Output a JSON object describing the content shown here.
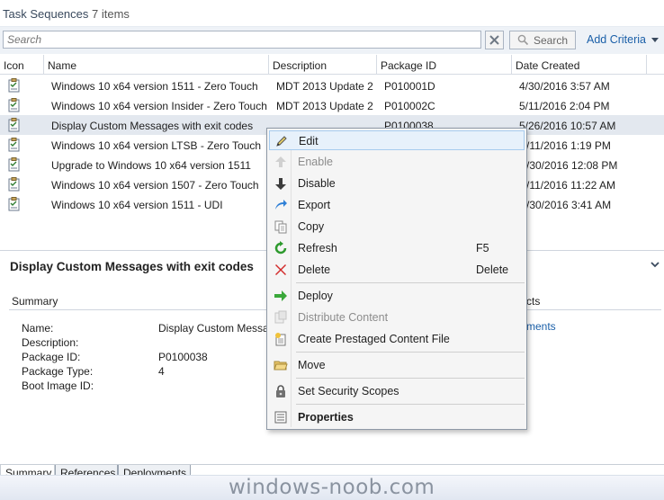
{
  "header": {
    "title": "Task Sequences",
    "count": "7 items"
  },
  "search": {
    "placeholder": "Search",
    "value": "Search",
    "button_label": "Search",
    "add_criteria_label": "Add Criteria"
  },
  "table": {
    "columns": [
      "Icon",
      "Name",
      "Description",
      "Package ID",
      "Date Created"
    ],
    "rows": [
      {
        "name": "Windows 10 x64 version 1511 - Zero Touch",
        "description": "MDT 2013 Update 2",
        "package_id": "P010001D",
        "date_created": "4/30/2016 3:57 AM"
      },
      {
        "name": "Windows 10 x64 version Insider - Zero Touch",
        "description": "MDT 2013 Update 2",
        "package_id": "P010002C",
        "date_created": "5/11/2016 2:04 PM"
      },
      {
        "name": "Display Custom Messages with exit codes",
        "description": "",
        "package_id": "P0100038",
        "date_created": "5/26/2016 10:57 AM"
      },
      {
        "name": "Windows 10 x64 version LTSB - Zero Touch",
        "description": "",
        "package_id": "",
        "date_created": "/11/2016 1:19 PM"
      },
      {
        "name": "Upgrade to Windows 10 x64 version 1511",
        "description": "",
        "package_id": "",
        "date_created": "/30/2016 12:08 PM"
      },
      {
        "name": "Windows 10 x64 version 1507 - Zero Touch",
        "description": "",
        "package_id": "",
        "date_created": "/11/2016 11:22 AM"
      },
      {
        "name": "Windows 10 x64 version 1511 - UDI",
        "description": "",
        "package_id": "",
        "date_created": "/30/2016 3:41 AM"
      }
    ]
  },
  "details": {
    "title": "Display Custom Messages with exit codes",
    "summary_label": "Summary",
    "related_label": "cts",
    "related_link": "ments",
    "props": [
      {
        "name": "Name:",
        "value": "Display Custom Messa"
      },
      {
        "name": "Description:",
        "value": ""
      },
      {
        "name": "Package ID:",
        "value": "P0100038"
      },
      {
        "name": "Package Type:",
        "value": "4"
      },
      {
        "name": "Boot Image ID:",
        "value": ""
      }
    ]
  },
  "bottom_tabs": [
    "Summary",
    "References",
    "Deployments"
  ],
  "watermark": "windows-noob.com",
  "context_menu": {
    "items": [
      {
        "label": "Edit",
        "shortcut": "",
        "icon": "pencil-icon",
        "state": "hover"
      },
      {
        "label": "Enable",
        "shortcut": "",
        "icon": "arrow-up-icon",
        "state": "disabled"
      },
      {
        "label": "Disable",
        "shortcut": "",
        "icon": "arrow-down-icon",
        "state": "normal"
      },
      {
        "label": "Export",
        "shortcut": "",
        "icon": "export-arrow-icon",
        "state": "normal"
      },
      {
        "label": "Copy",
        "shortcut": "",
        "icon": "copy-icon",
        "state": "normal"
      },
      {
        "label": "Refresh",
        "shortcut": "F5",
        "icon": "refresh-icon",
        "state": "normal"
      },
      {
        "label": "Delete",
        "shortcut": "Delete",
        "icon": "delete-x-icon",
        "state": "normal"
      },
      {
        "label": "Deploy",
        "shortcut": "",
        "icon": "deploy-arrow-icon",
        "state": "normal"
      },
      {
        "label": "Distribute Content",
        "shortcut": "",
        "icon": "distribute-content-icon",
        "state": "disabled"
      },
      {
        "label": "Create Prestaged Content File",
        "shortcut": "",
        "icon": "prestaged-content-icon",
        "state": "normal"
      },
      {
        "label": "Move",
        "shortcut": "",
        "icon": "folder-icon",
        "state": "normal"
      },
      {
        "label": "Set Security Scopes",
        "shortcut": "",
        "icon": "lock-icon",
        "state": "normal"
      },
      {
        "label": "Properties",
        "shortcut": "",
        "icon": "properties-icon",
        "state": "bold"
      }
    ]
  },
  "colors": {
    "accent_link": "#1a5fa8",
    "selected_row": "#e3e8ef",
    "menu_hover": "#e7f1fb"
  }
}
